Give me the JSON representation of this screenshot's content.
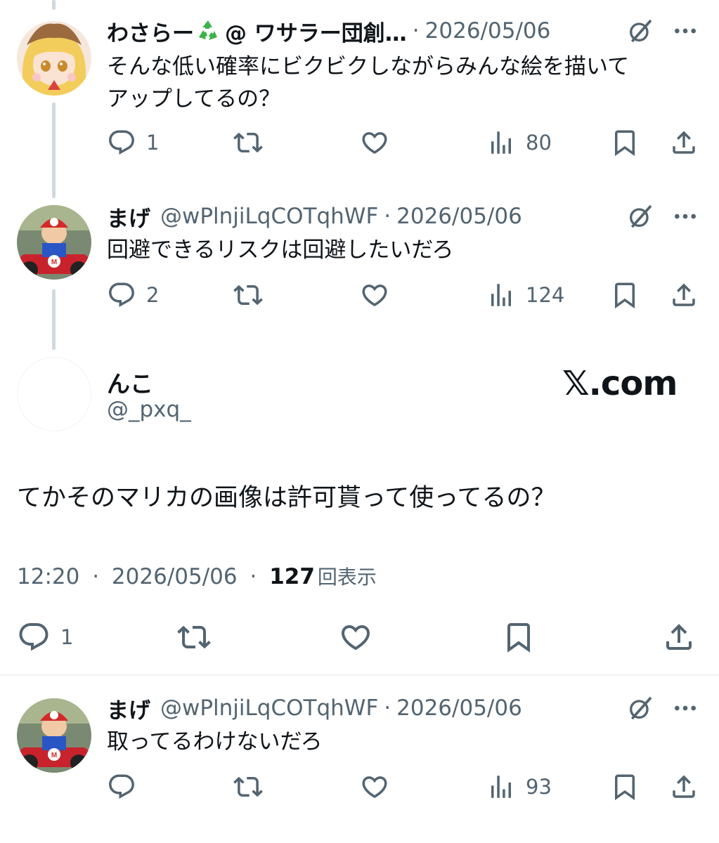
{
  "tweets": [
    {
      "name": "わさらー",
      "handle": "@ ワサラー団創…",
      "date": "2026/05/06",
      "text_line1": "そんな低い確率にビクビクしながらみんな絵を描いて",
      "text_line2": "アップしてるの？",
      "replies": "1",
      "views": "80"
    },
    {
      "name": "まげ",
      "handle": "@wPlnjiLqCOTqhWF",
      "date": "2026/05/06",
      "text_line1": "回避できるリスクは回避したいだろ",
      "replies": "2",
      "views": "124"
    },
    {
      "name": "まげ",
      "handle": "@wPlnjiLqCOTqhWF",
      "date": "2026/05/06",
      "text_line1": "取ってるわけないだろ",
      "replies": "",
      "views": "93"
    }
  ],
  "main_tweet": {
    "name": "んこ",
    "handle": "@_pxq_",
    "brand": "𝕏.com",
    "text": "てかそのマリカの画像は許可貰って使ってるの？",
    "time": "12:20",
    "date": "2026/05/06",
    "views_count": "127",
    "views_label": "回表示",
    "replies": "1"
  },
  "separator": "·",
  "icons": {
    "reply": "reply-icon",
    "retweet": "retweet-icon",
    "like": "like-icon",
    "views": "views-icon",
    "bookmark": "bookmark-icon",
    "share": "share-icon",
    "grok": "grok-icon",
    "more": "more-icon"
  },
  "colors": {
    "text": "#0f1419",
    "muted": "#536471",
    "thread_line": "#cfd9de",
    "divider": "#eff3f4"
  }
}
